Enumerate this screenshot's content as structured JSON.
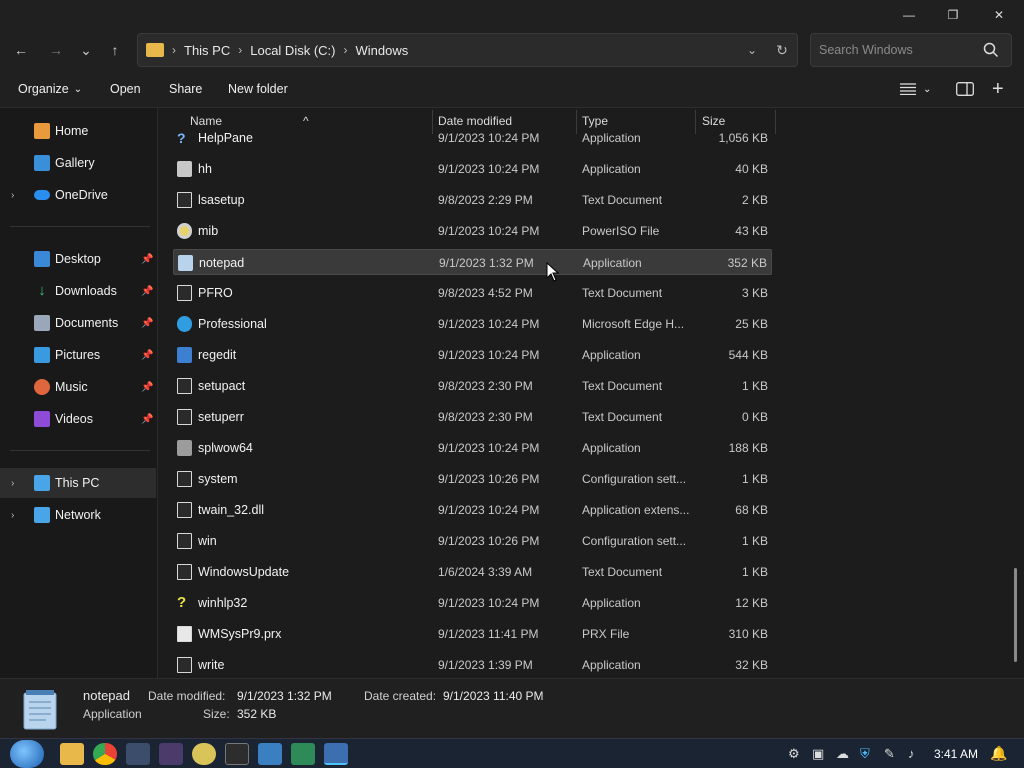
{
  "window": {
    "controls": {
      "minimize": "—",
      "restore": "❐",
      "close": "✕"
    }
  },
  "nav": {
    "back": "←",
    "forward": "→",
    "recent": "⌄",
    "up": "↑",
    "breadcrumbs": [
      "This PC",
      "Local Disk (C:)",
      "Windows"
    ],
    "search_placeholder": "Search Windows"
  },
  "commands": {
    "organize": "Organize",
    "open": "Open",
    "share": "Share",
    "new_folder": "New folder"
  },
  "sidebar": {
    "items": [
      {
        "label": "Home",
        "icon": "home-icon"
      },
      {
        "label": "Gallery",
        "icon": "gallery-icon"
      },
      {
        "label": "OneDrive",
        "icon": "onedrive-icon"
      },
      {
        "label": "Desktop",
        "icon": "desktop-icon"
      },
      {
        "label": "Downloads",
        "icon": "downloads-icon"
      },
      {
        "label": "Documents",
        "icon": "documents-icon"
      },
      {
        "label": "Pictures",
        "icon": "pictures-icon"
      },
      {
        "label": "Music",
        "icon": "music-icon"
      },
      {
        "label": "Videos",
        "icon": "videos-icon"
      },
      {
        "label": "This PC",
        "icon": "computer-icon"
      },
      {
        "label": "Network",
        "icon": "network-icon"
      }
    ]
  },
  "columns": {
    "name": "Name",
    "date": "Date modified",
    "type": "Type",
    "size": "Size"
  },
  "files": [
    {
      "name": "HelpPane",
      "date": "9/1/2023 10:24 PM",
      "type": "Application",
      "size": "1,056 KB",
      "icon": "help-icon"
    },
    {
      "name": "hh",
      "date": "9/1/2023 10:24 PM",
      "type": "Application",
      "size": "40 KB",
      "icon": "help-app-icon"
    },
    {
      "name": "lsasetup",
      "date": "9/8/2023 2:29 PM",
      "type": "Text Document",
      "size": "2 KB",
      "icon": "text-file-icon"
    },
    {
      "name": "mib",
      "date": "9/1/2023 10:24 PM",
      "type": "PowerISO File",
      "size": "43 KB",
      "icon": "disc-icon"
    },
    {
      "name": "notepad",
      "date": "9/1/2023 1:32 PM",
      "type": "Application",
      "size": "352 KB",
      "icon": "notepad-icon"
    },
    {
      "name": "PFRO",
      "date": "9/8/2023 4:52 PM",
      "type": "Text Document",
      "size": "3 KB",
      "icon": "text-file-icon"
    },
    {
      "name": "Professional",
      "date": "9/1/2023 10:24 PM",
      "type": "Microsoft Edge H...",
      "size": "25 KB",
      "icon": "edge-icon"
    },
    {
      "name": "regedit",
      "date": "9/1/2023 10:24 PM",
      "type": "Application",
      "size": "544 KB",
      "icon": "regedit-icon"
    },
    {
      "name": "setupact",
      "date": "9/8/2023 2:30 PM",
      "type": "Text Document",
      "size": "1 KB",
      "icon": "text-file-icon"
    },
    {
      "name": "setuperr",
      "date": "9/8/2023 2:30 PM",
      "type": "Text Document",
      "size": "0 KB",
      "icon": "text-file-icon"
    },
    {
      "name": "splwow64",
      "date": "9/1/2023 10:24 PM",
      "type": "Application",
      "size": "188 KB",
      "icon": "printer-icon"
    },
    {
      "name": "system",
      "date": "9/1/2023 10:26 PM",
      "type": "Configuration sett...",
      "size": "1 KB",
      "icon": "config-file-icon"
    },
    {
      "name": "twain_32.dll",
      "date": "9/1/2023 10:24 PM",
      "type": "Application extens...",
      "size": "68 KB",
      "icon": "dll-file-icon"
    },
    {
      "name": "win",
      "date": "9/1/2023 10:26 PM",
      "type": "Configuration sett...",
      "size": "1 KB",
      "icon": "config-file-icon"
    },
    {
      "name": "WindowsUpdate",
      "date": "1/6/2024 3:39 AM",
      "type": "Text Document",
      "size": "1 KB",
      "icon": "text-file-icon"
    },
    {
      "name": "winhlp32",
      "date": "9/1/2023 10:24 PM",
      "type": "Application",
      "size": "12 KB",
      "icon": "help-question-icon"
    },
    {
      "name": "WMSysPr9.prx",
      "date": "9/1/2023 11:41 PM",
      "type": "PRX File",
      "size": "310 KB",
      "icon": "blank-file-icon"
    },
    {
      "name": "write",
      "date": "9/1/2023 1:39 PM",
      "type": "Application",
      "size": "32 KB",
      "icon": "write-icon"
    }
  ],
  "details": {
    "name": "notepad",
    "kind": "Application",
    "date_modified_label": "Date modified:",
    "date_modified": "9/1/2023 1:32 PM",
    "size_label": "Size:",
    "size": "352 KB",
    "date_created_label": "Date created:",
    "date_created": "9/1/2023 11:40 PM"
  },
  "taskbar": {
    "clock": "3:41 AM"
  },
  "colors": {
    "accent": "#4cc2ff",
    "folder": "#e8b84a",
    "selected_row": "#3a3a3a"
  }
}
